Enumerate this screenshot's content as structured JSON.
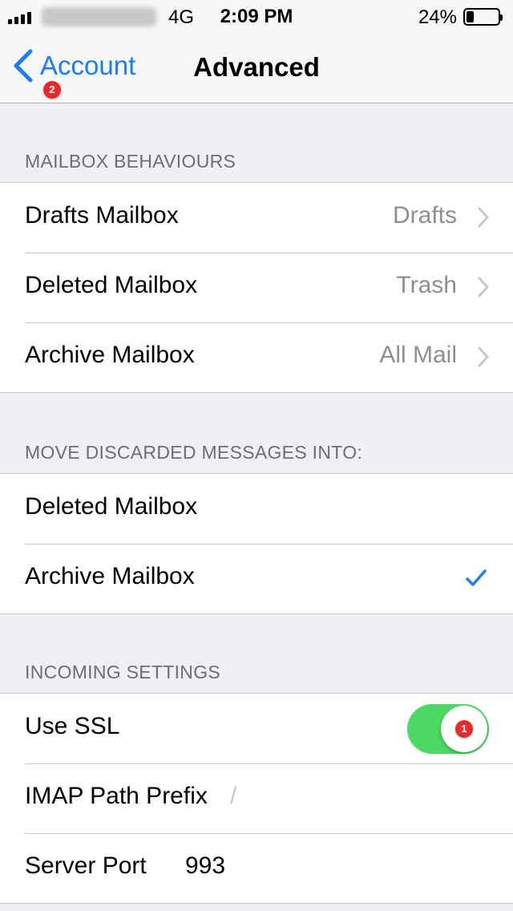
{
  "status_bar": {
    "network": "4G",
    "time": "2:09 PM",
    "battery": "24%",
    "battery_level": 0.24
  },
  "nav": {
    "back_label": "Account",
    "back_badge": "2",
    "title": "Advanced"
  },
  "sections": {
    "mailbox_behaviours": {
      "header": "MAILBOX BEHAVIOURS",
      "rows": [
        {
          "label": "Drafts Mailbox",
          "value": "Drafts"
        },
        {
          "label": "Deleted Mailbox",
          "value": "Trash"
        },
        {
          "label": "Archive Mailbox",
          "value": "All Mail"
        }
      ]
    },
    "move_discarded": {
      "header": "MOVE DISCARDED MESSAGES INTO:",
      "rows": [
        {
          "label": "Deleted Mailbox",
          "selected": false
        },
        {
          "label": "Archive Mailbox",
          "selected": true
        }
      ]
    },
    "incoming": {
      "header": "INCOMING SETTINGS",
      "use_ssl": {
        "label": "Use SSL",
        "on": true,
        "badge": "1"
      },
      "imap_path": {
        "label": "IMAP Path Prefix",
        "value": "/"
      },
      "server_port": {
        "label": "Server Port",
        "value": "993"
      }
    }
  },
  "colors": {
    "accent": "#1e7cf8",
    "toggle_on": "#4cd964",
    "badge": "#e32b2b"
  },
  "icons": {
    "back": "chevron-left-icon",
    "disclosure": "chevron-right-icon",
    "selected": "checkmark-icon"
  }
}
